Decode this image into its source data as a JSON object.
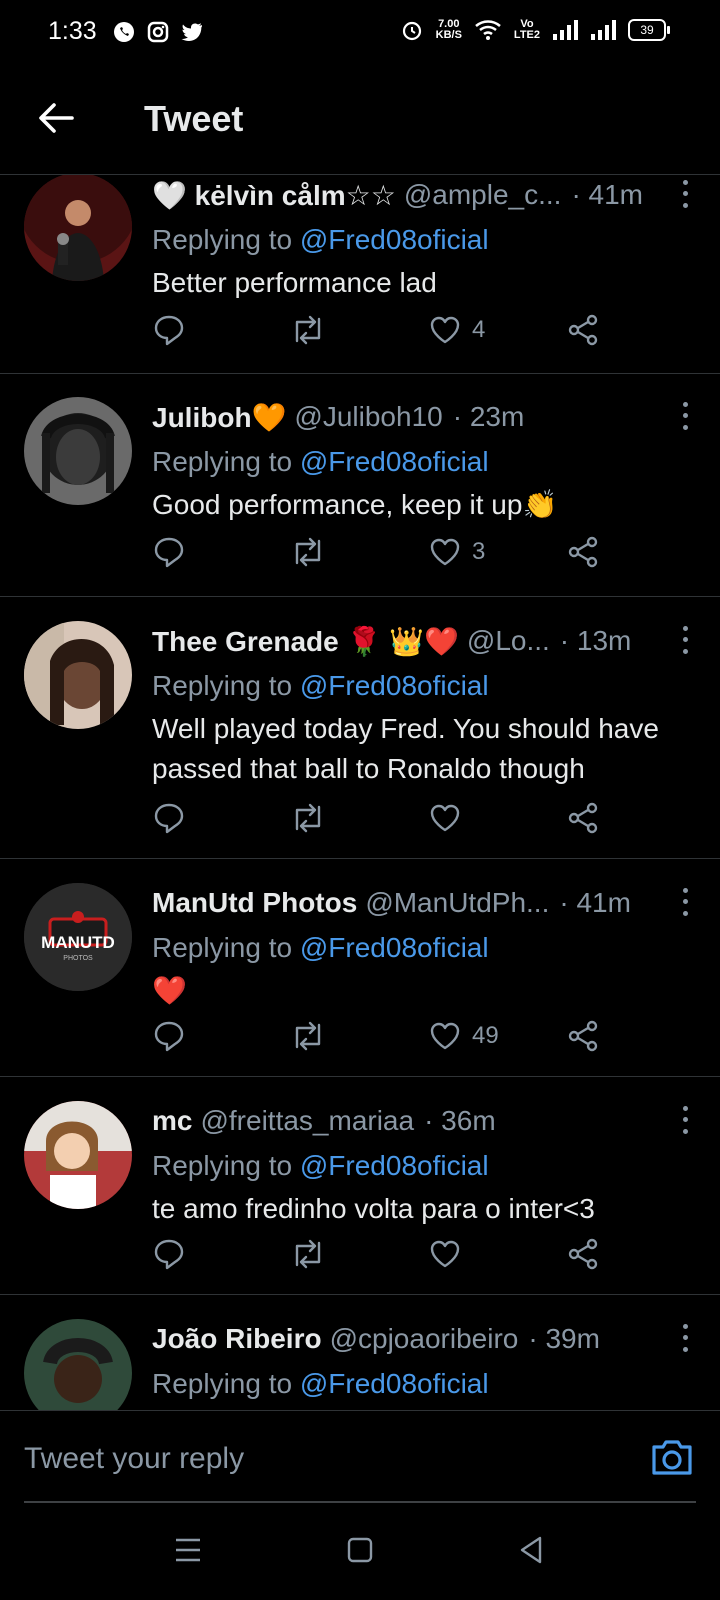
{
  "status_bar": {
    "time": "1:33",
    "net_speed_value": "7.00",
    "net_speed_unit": "KB/S",
    "volte_top": "Vo",
    "volte_bottom": "LTE2",
    "battery": "39"
  },
  "header": {
    "title": "Tweet"
  },
  "replies": [
    {
      "name": "🤍 kėlvìn cålm☆☆",
      "handle": "@ample_c...",
      "time": "· 41m",
      "replying_prefix": "Replying to",
      "replying_to": "@Fred08oficial",
      "text": "Better performance lad",
      "likes": "4"
    },
    {
      "name": "Juliboh🧡",
      "handle": "@Juliboh10",
      "time": "· 23m",
      "replying_prefix": "Replying to",
      "replying_to": "@Fred08oficial",
      "text": "Good performance, keep it up👏",
      "likes": "3"
    },
    {
      "name": "Thee Grenade 🌹 👑❤️",
      "handle": "@Lo...",
      "time": "· 13m",
      "replying_prefix": "Replying to",
      "replying_to": "@Fred08oficial",
      "text": "Well played today Fred. You should have passed that ball to Ronaldo though",
      "likes": ""
    },
    {
      "name": "ManUtd Photos",
      "handle": "@ManUtdPh...",
      "time": "· 41m",
      "replying_prefix": "Replying to",
      "replying_to": "@Fred08oficial",
      "text": "❤️",
      "likes": "49",
      "avatar_text": "MANUTD",
      "avatar_subtext": "PHOTOS"
    },
    {
      "name": "mc",
      "handle": "@freittas_mariaa",
      "time": "· 36m",
      "replying_prefix": "Replying to",
      "replying_to": "@Fred08oficial",
      "text": "te amo fredinho volta para o inter<3",
      "likes": ""
    },
    {
      "name": "João Ribeiro",
      "handle": "@cpjoaoribeiro",
      "time": "· 39m",
      "replying_prefix": "Replying to",
      "replying_to": "@Fred08oficial",
      "text": "",
      "likes": ""
    }
  ],
  "composer": {
    "placeholder": "Tweet your reply"
  },
  "colors": {
    "background": "#000000",
    "accent": "#4a99e9",
    "muted": "#8b98a5",
    "divider": "#2f3336"
  }
}
